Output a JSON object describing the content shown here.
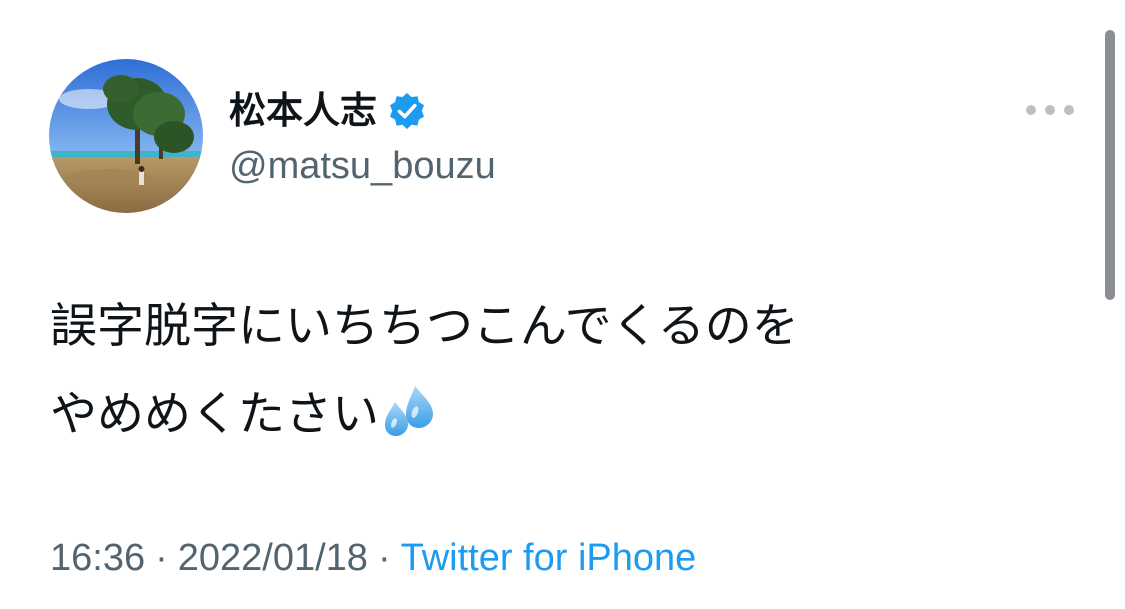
{
  "author": {
    "display_name": "松本人志",
    "handle": "@matsu_bouzu",
    "verified": true,
    "avatar_icon": "profile-photo-beach-trees"
  },
  "tweet": {
    "text_line1": "誤字脱字にいちちつこんでくるのを",
    "text_line2": "やめめくたさい",
    "emoji": "sweat-droplets-icon"
  },
  "meta": {
    "time": "16:36",
    "separator1": "·",
    "date": "2022/01/18",
    "separator2": "·",
    "source": "Twitter for iPhone"
  },
  "colors": {
    "text": "#0f1419",
    "secondary": "#536471",
    "link": "#1d9bf0",
    "verified": "#1d9bf0"
  }
}
